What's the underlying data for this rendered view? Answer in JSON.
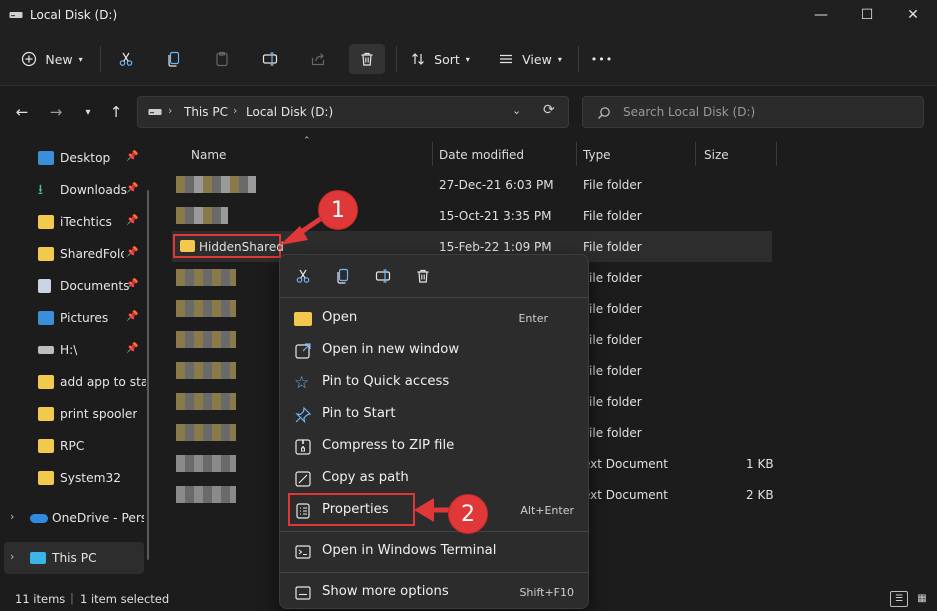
{
  "window": {
    "title": "Local Disk (D:)",
    "minimize": "—",
    "maximize": "☐",
    "close": "✕"
  },
  "toolbar": {
    "new_label": "New",
    "sort_label": "Sort",
    "view_label": "View",
    "more": "•••"
  },
  "address": {
    "root": "This PC",
    "current": "Local Disk (D:)"
  },
  "search": {
    "placeholder": "Search Local Disk (D:)"
  },
  "sidebar": {
    "items": [
      {
        "label": "Desktop",
        "pinned": true
      },
      {
        "label": "Downloads",
        "pinned": true
      },
      {
        "label": "iTechtics",
        "pinned": true
      },
      {
        "label": "SharedFolde",
        "pinned": true
      },
      {
        "label": "Documents",
        "pinned": true
      },
      {
        "label": "Pictures",
        "pinned": true
      },
      {
        "label": "H:\\",
        "pinned": true
      },
      {
        "label": "add app to star",
        "pinned": false
      },
      {
        "label": "print spooler",
        "pinned": false
      },
      {
        "label": "RPC",
        "pinned": false
      },
      {
        "label": "System32",
        "pinned": false
      }
    ],
    "onedrive": "OneDrive - Perso",
    "thispc": "This PC"
  },
  "columns": {
    "name": "Name",
    "date": "Date modified",
    "type": "Type",
    "size": "Size"
  },
  "files": [
    {
      "name": "",
      "date": "27-Dec-21 6:03 PM",
      "type": "File folder",
      "size": ""
    },
    {
      "name": "",
      "date": "15-Oct-21 3:35 PM",
      "type": "File folder",
      "size": ""
    },
    {
      "name": "HiddenShared",
      "date": "15-Feb-22 1:09 PM",
      "type": "File folder",
      "size": ""
    },
    {
      "name": "",
      "date": "",
      "type": "File folder",
      "size": ""
    },
    {
      "name": "",
      "date": "",
      "type": "File folder",
      "size": ""
    },
    {
      "name": "",
      "date": "",
      "type": "File folder",
      "size": ""
    },
    {
      "name": "",
      "date": "",
      "type": "File folder",
      "size": ""
    },
    {
      "name": "",
      "date": "",
      "type": "File folder",
      "size": ""
    },
    {
      "name": "",
      "date": "",
      "type": "File folder",
      "size": ""
    },
    {
      "name": "",
      "date": "",
      "type": "ext Document",
      "size": "1 KB"
    },
    {
      "name": "",
      "date": "",
      "type": "ext Document",
      "size": "2 KB"
    }
  ],
  "context_menu": {
    "items": [
      {
        "label": "Open",
        "shortcut": "Enter"
      },
      {
        "label": "Open in new window",
        "shortcut": ""
      },
      {
        "label": "Pin to Quick access",
        "shortcut": ""
      },
      {
        "label": "Pin to Start",
        "shortcut": ""
      },
      {
        "label": "Compress to ZIP file",
        "shortcut": ""
      },
      {
        "label": "Copy as path",
        "shortcut": ""
      },
      {
        "label": "Properties",
        "shortcut": "Alt+Enter"
      },
      {
        "label": "Open in Windows Terminal",
        "shortcut": ""
      },
      {
        "label": "Show more options",
        "shortcut": "Shift+F10"
      }
    ]
  },
  "status": {
    "count": "11 items",
    "selected": "1 item selected"
  },
  "annotations": {
    "step1": "1",
    "step2": "2"
  },
  "colors": {
    "accent": "#e03838",
    "folder": "#f2c94c",
    "background": "#1c1c1c"
  }
}
